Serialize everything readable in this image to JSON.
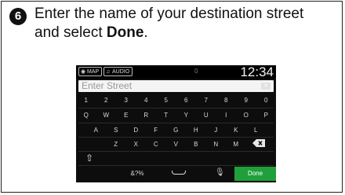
{
  "instruction": {
    "step_number": "6",
    "text_before": "Enter the name of your destination street and select ",
    "text_bold": "Done",
    "text_after": "."
  },
  "screen": {
    "top_bar": {
      "map_label": "MAP",
      "audio_label": "AUDIO",
      "status_dot": "0",
      "clock": "12:34"
    },
    "entry": {
      "placeholder": "Enter Street"
    },
    "keyboard": {
      "row1": [
        "1",
        "2",
        "3",
        "4",
        "5",
        "6",
        "7",
        "8",
        "9",
        "0"
      ],
      "row2": [
        "Q",
        "W",
        "E",
        "R",
        "T",
        "Y",
        "U",
        "I",
        "O",
        "P"
      ],
      "row3": [
        "A",
        "S",
        "D",
        "F",
        "G",
        "H",
        "J",
        "K",
        "L"
      ],
      "row4": [
        "Z",
        "X",
        "C",
        "V",
        "B",
        "N",
        "M"
      ],
      "symbols_label": "&?%",
      "done_label": "Done"
    }
  }
}
